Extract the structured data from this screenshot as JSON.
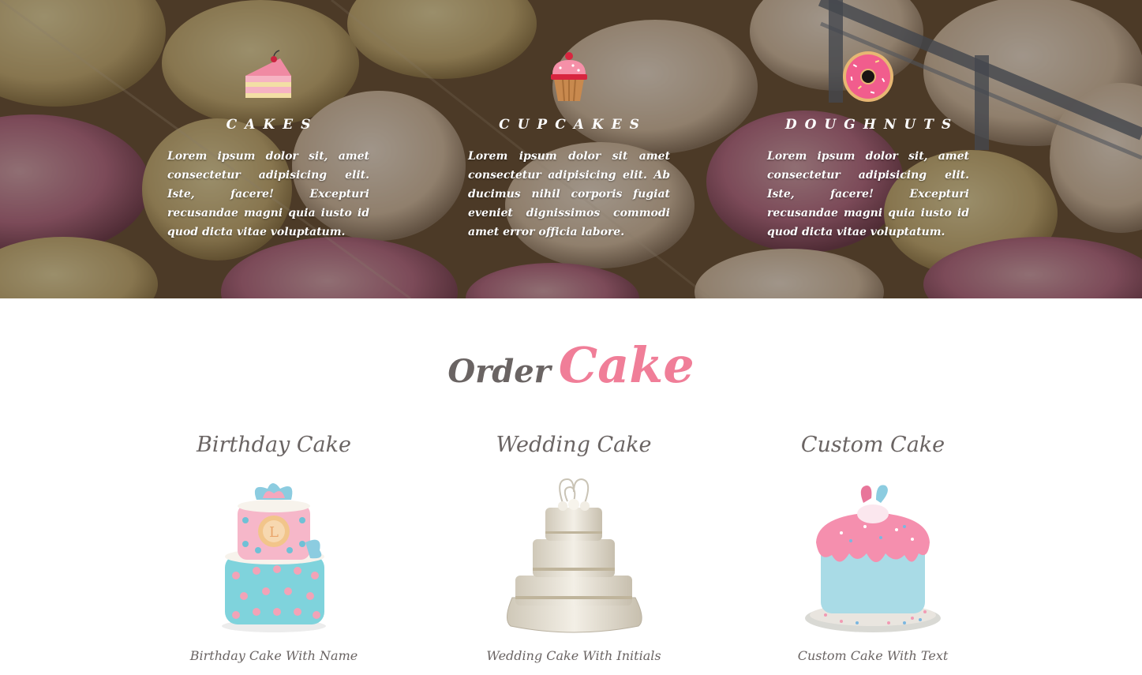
{
  "features": [
    {
      "icon": "cake-slice-icon",
      "title": "CAKES",
      "text": "Lorem ipsum dolor sit, amet consectetur adipisicing elit. Iste, facere! Excepturi recusandae magni quia iusto id quod dicta vitae voluptatum."
    },
    {
      "icon": "cupcake-icon",
      "title": "CUPCAKES",
      "text": "Lorem ipsum dolor sit amet consectetur adipisicing elit. Ab ducimus nihil corporis fugiat eveniet dignissimos commodi amet error officia labore."
    },
    {
      "icon": "doughnut-icon",
      "title": "DOUGHNUTS",
      "text": "Lorem ipsum dolor sit, amet consectetur adipisicing elit. Iste, facere! Excepturi recusandae magni quia iusto id quod dicta vitae voluptatum."
    }
  ],
  "order": {
    "title_part1": "Order",
    "title_part2": "Cake",
    "products": [
      {
        "name": "Birthday Cake",
        "image": "birthday-cake-image",
        "caption": "Birthday Cake With Name"
      },
      {
        "name": "Wedding Cake",
        "image": "wedding-cake-image",
        "caption": "Wedding Cake With Initials"
      },
      {
        "name": "Custom Cake",
        "image": "custom-cake-image",
        "caption": "Custom Cake With Text"
      }
    ]
  },
  "colors": {
    "accent_pink": "#f07e98",
    "text_gray": "#6a6463",
    "hero_overlay": "#1e1610"
  }
}
